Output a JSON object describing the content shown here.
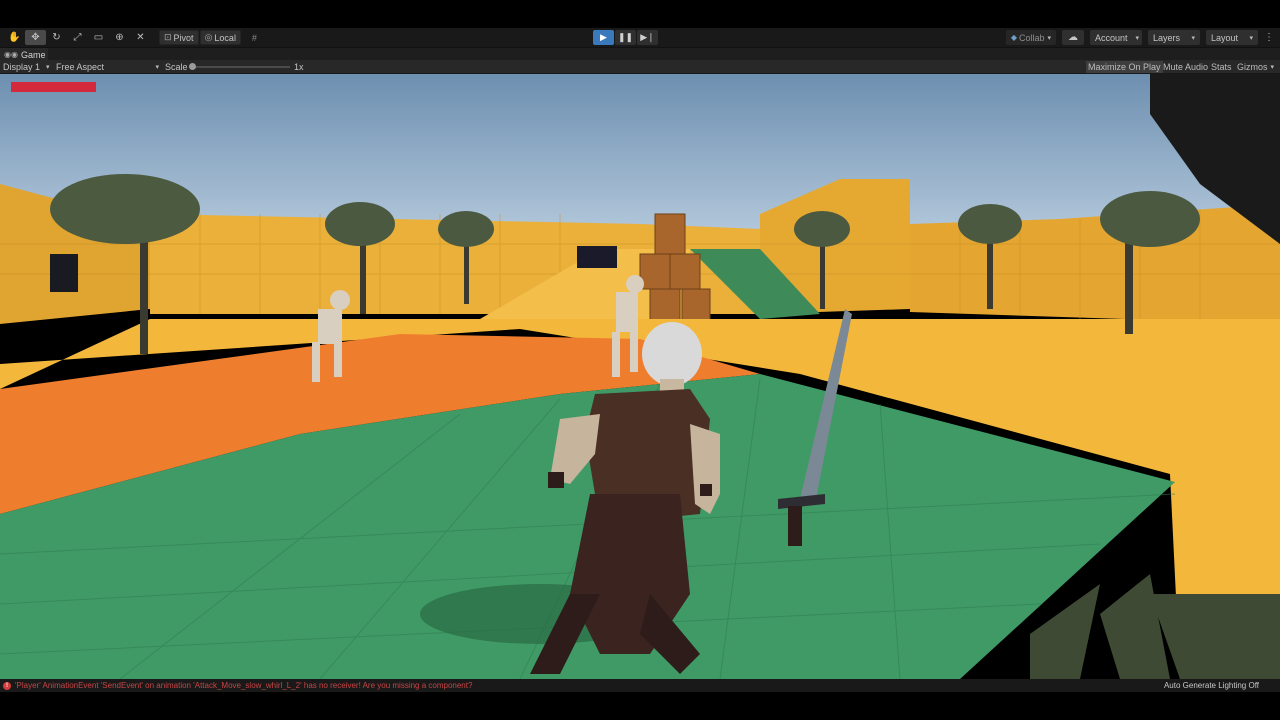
{
  "toolbar": {
    "tools": [
      {
        "name": "hand-tool",
        "glyph": "✋",
        "active": false
      },
      {
        "name": "move-tool",
        "glyph": "✥",
        "active": true
      },
      {
        "name": "rotate-tool",
        "glyph": "↻",
        "active": false
      },
      {
        "name": "scale-tool",
        "glyph": "⤢",
        "active": false
      },
      {
        "name": "rect-tool",
        "glyph": "▭",
        "active": false
      },
      {
        "name": "transform-tool",
        "glyph": "⊕",
        "active": false
      },
      {
        "name": "custom-tool",
        "glyph": "✕",
        "active": false
      }
    ],
    "pivot_label": "Pivot",
    "local_label": "Local",
    "play_state": "playing",
    "collab_label": "Collab",
    "account_label": "Account",
    "layers_label": "Layers",
    "layout_label": "Layout"
  },
  "tab": {
    "title": "Game"
  },
  "game_controls": {
    "display": "Display 1",
    "aspect": "Free Aspect",
    "scale_label": "Scale",
    "scale_value": "1x",
    "scale_level": 0.0,
    "maximize_on_play": "Maximize On Play",
    "mute_audio": "Mute Audio",
    "stats": "Stats",
    "gizmos": "Gizmos"
  },
  "game_view": {
    "player_health_fraction": 1.0,
    "health_color": "#d22a3c"
  },
  "status": {
    "error_message": "'Player' AnimationEvent 'SendEvent' on animation 'Attack_Move_slow_whirl_L_2' has no receiver! Are you missing a component?",
    "right_text": "Auto Generate Lighting Off"
  },
  "colors": {
    "accent": "#3a79bb",
    "error": "#c64545"
  }
}
